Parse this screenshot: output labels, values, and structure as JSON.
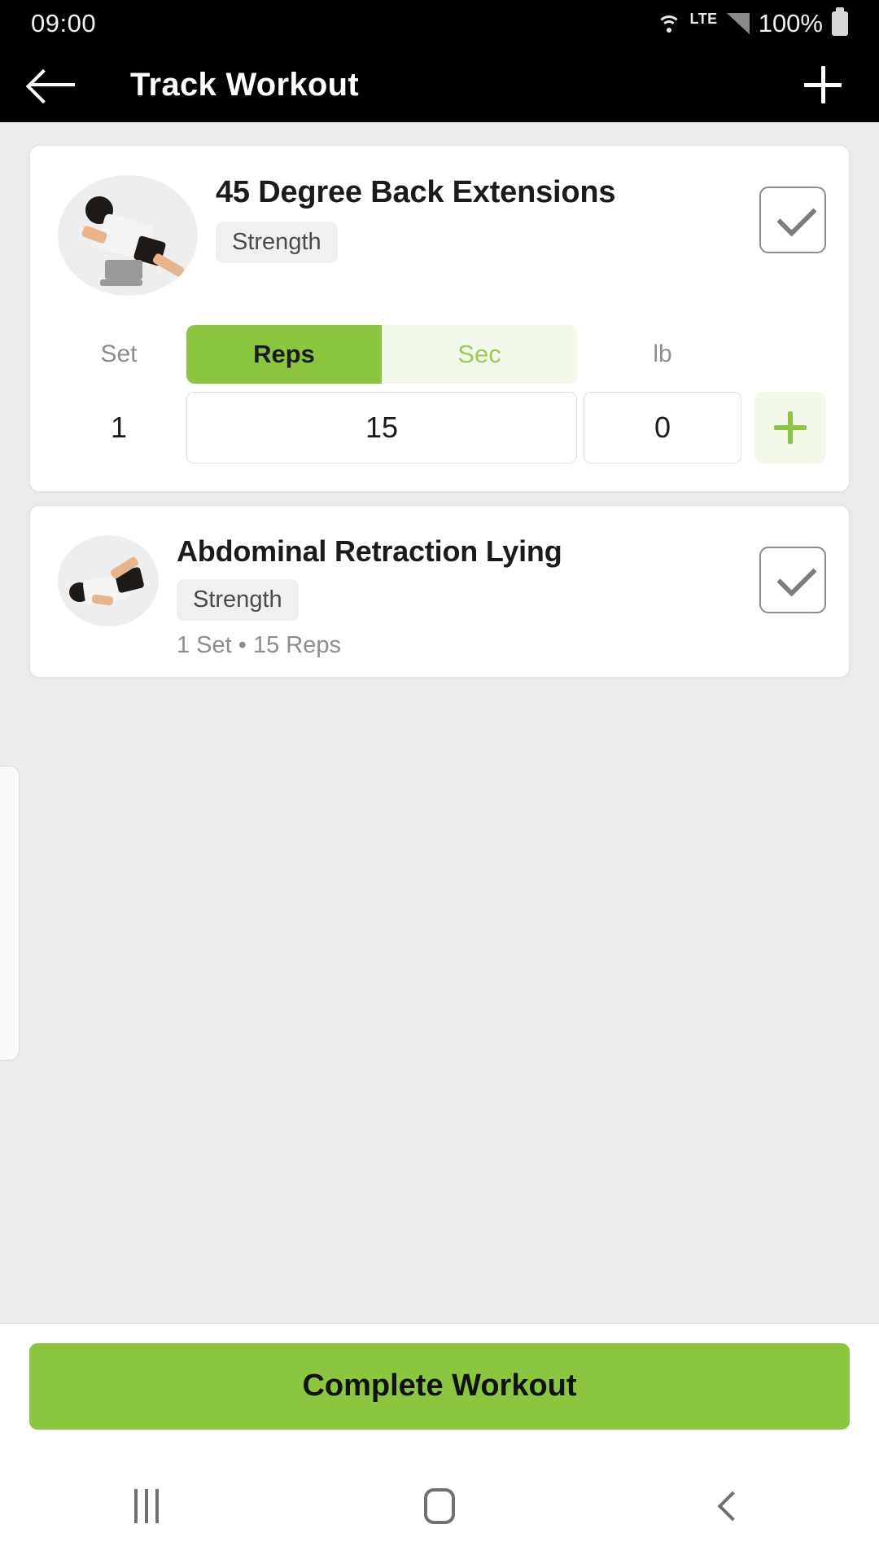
{
  "status_bar": {
    "time": "09:00",
    "network_type": "LTE",
    "battery_percent": "100%",
    "icons": [
      "wifi-icon",
      "signal-icon",
      "battery-icon"
    ]
  },
  "app_bar": {
    "title": "Track Workout",
    "back_icon": "back-arrow-icon",
    "add_icon": "plus-icon"
  },
  "exercises": [
    {
      "name": "45 Degree Back Extensions",
      "category": "Strength",
      "completed_icon": "checkmark-icon",
      "expanded": true,
      "columns": {
        "set": "Set",
        "weight_unit": "lb"
      },
      "unit_toggle": {
        "options": [
          "Reps",
          "Sec"
        ],
        "selected": "Reps"
      },
      "sets": [
        {
          "index": "1",
          "reps": "15",
          "weight": "0"
        }
      ],
      "add_set_icon": "plus-icon"
    },
    {
      "name": "Abdominal Retraction Lying",
      "category": "Strength",
      "completed_icon": "checkmark-icon",
      "expanded": false,
      "summary": "1 Set • 15 Reps"
    }
  ],
  "footer": {
    "complete_label": "Complete Workout"
  },
  "nav_bar": {
    "recents": "recents-icon",
    "home": "home-icon",
    "back": "back-icon"
  },
  "colors": {
    "accent_green": "#8cc63f",
    "accent_green_pale": "#f2f8ea",
    "app_bar_bg": "#000000",
    "page_bg": "#ebebeb",
    "card_bg": "#ffffff",
    "muted_text": "#8d8d8d"
  }
}
